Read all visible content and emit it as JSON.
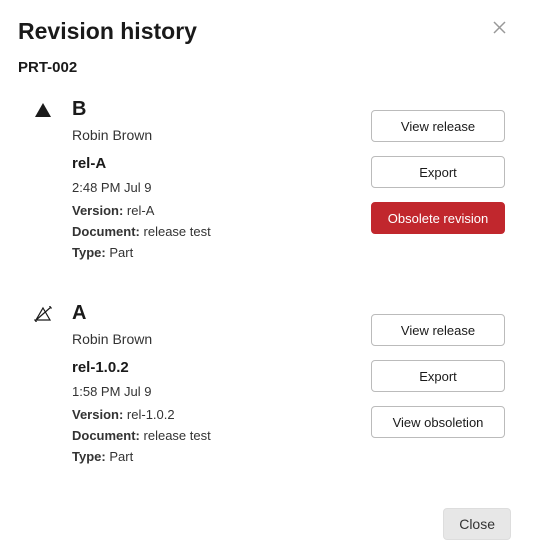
{
  "dialog": {
    "title": "Revision history",
    "part_number": "PRT-002",
    "close_label": "Close"
  },
  "buttons": {
    "view_release": "View release",
    "export": "Export",
    "obsolete_revision": "Obsolete revision",
    "view_obsoletion": "View obsoletion"
  },
  "labels": {
    "version": "Version:",
    "document": "Document:",
    "type": "Type:"
  },
  "revisions": [
    {
      "letter": "B",
      "author": "Robin Brown",
      "release_name": "rel-A",
      "timestamp": "2:48 PM Jul 9",
      "version": "rel-A",
      "document": "release test",
      "type": "Part",
      "status": "current"
    },
    {
      "letter": "A",
      "author": "Robin Brown",
      "release_name": "rel-1.0.2",
      "timestamp": "1:58 PM Jul 9",
      "version": "rel-1.0.2",
      "document": "release test",
      "type": "Part",
      "status": "obsolete"
    }
  ]
}
